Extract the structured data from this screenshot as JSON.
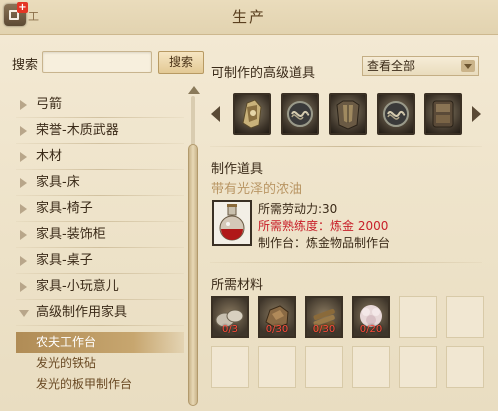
{
  "window": {
    "title": "生产",
    "app_label": "工"
  },
  "search": {
    "label": "搜索",
    "value": "",
    "placeholder": "",
    "button_label": "搜索"
  },
  "categories": [
    {
      "label": "弓箭",
      "state": "collapsed"
    },
    {
      "label": "荣誉-木质武器",
      "state": "collapsed"
    },
    {
      "label": "木材",
      "state": "collapsed"
    },
    {
      "label": "家具-床",
      "state": "collapsed"
    },
    {
      "label": "家具-椅子",
      "state": "collapsed"
    },
    {
      "label": "家具-装饰柜",
      "state": "collapsed"
    },
    {
      "label": "家具-桌子",
      "state": "collapsed"
    },
    {
      "label": "家具-小玩意儿",
      "state": "collapsed"
    },
    {
      "label": "高级制作用家具",
      "state": "expanded"
    }
  ],
  "subcategories": [
    {
      "label": "农夫工作台",
      "selected": true
    },
    {
      "label": "发光的铁砧",
      "selected": false
    },
    {
      "label": "发光的板甲制作台",
      "selected": false
    }
  ],
  "craftable": {
    "title": "可制作的高级道具",
    "filter_value": "查看全部",
    "items": [
      {
        "icon": "armor-shoulder-icon"
      },
      {
        "icon": "knot-emblem-icon"
      },
      {
        "icon": "plate-armor-icon"
      },
      {
        "icon": "knot-emblem-icon"
      },
      {
        "icon": "armor-piece-icon"
      }
    ]
  },
  "production": {
    "section_title": "制作道具",
    "item_name": "带有光泽的浓油",
    "item_icon": "potion-flask-icon",
    "labor_text": "所需劳动力:30",
    "proficiency_text": "所需熟练度：炼金 2000",
    "station_text": "制作台：炼金物品制作台"
  },
  "materials": {
    "title": "所需材料",
    "items": [
      {
        "icon": "stone-pile-icon",
        "count": "0/3"
      },
      {
        "icon": "ore-lump-icon",
        "count": "0/30"
      },
      {
        "icon": "wood-bundle-icon",
        "count": "0/30"
      },
      {
        "icon": "coral-flower-icon",
        "count": "0/20"
      }
    ],
    "empty_slots": 8
  },
  "colors": {
    "background": "#efe4cc",
    "selected_row": "#b08c56",
    "warning_red": "#c8202a",
    "item_name_gold": "#b99664"
  }
}
